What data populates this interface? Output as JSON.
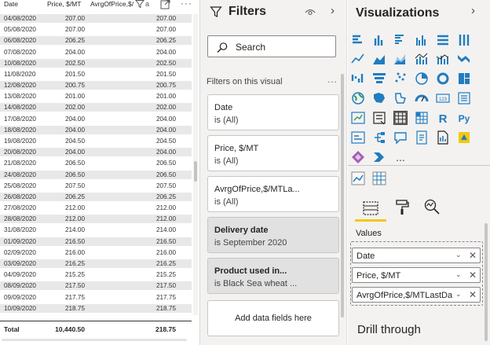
{
  "table": {
    "headers": {
      "date": "Date",
      "price": "Price, $/MT",
      "avg": "AvrgOfPrice,$/"
    },
    "header_overlay_text": "a",
    "rows": [
      {
        "date": "04/08/2020",
        "price": "207.00",
        "avg": "207.00"
      },
      {
        "date": "05/08/2020",
        "price": "207.00",
        "avg": "207.00"
      },
      {
        "date": "06/08/2020",
        "price": "206.25",
        "avg": "206.25"
      },
      {
        "date": "07/08/2020",
        "price": "204.00",
        "avg": "204.00"
      },
      {
        "date": "10/08/2020",
        "price": "202.50",
        "avg": "202.50"
      },
      {
        "date": "11/08/2020",
        "price": "201.50",
        "avg": "201.50"
      },
      {
        "date": "12/08/2020",
        "price": "200.75",
        "avg": "200.75"
      },
      {
        "date": "13/08/2020",
        "price": "201.00",
        "avg": "201.00"
      },
      {
        "date": "14/08/2020",
        "price": "202.00",
        "avg": "202.00"
      },
      {
        "date": "17/08/2020",
        "price": "204.00",
        "avg": "204.00"
      },
      {
        "date": "18/08/2020",
        "price": "204.00",
        "avg": "204.00"
      },
      {
        "date": "19/08/2020",
        "price": "204.50",
        "avg": "204.50"
      },
      {
        "date": "20/08/2020",
        "price": "204.00",
        "avg": "204.00"
      },
      {
        "date": "21/08/2020",
        "price": "206.50",
        "avg": "206.50"
      },
      {
        "date": "24/08/2020",
        "price": "206.50",
        "avg": "206.50"
      },
      {
        "date": "25/08/2020",
        "price": "207.50",
        "avg": "207.50"
      },
      {
        "date": "26/08/2020",
        "price": "206.25",
        "avg": "206.25"
      },
      {
        "date": "27/08/2020",
        "price": "212.00",
        "avg": "212.00"
      },
      {
        "date": "28/08/2020",
        "price": "212.00",
        "avg": "212.00"
      },
      {
        "date": "31/08/2020",
        "price": "214.00",
        "avg": "214.00"
      },
      {
        "date": "01/09/2020",
        "price": "216.50",
        "avg": "216.50"
      },
      {
        "date": "02/09/2020",
        "price": "216.00",
        "avg": "216.00"
      },
      {
        "date": "03/09/2020",
        "price": "216.25",
        "avg": "216.25"
      },
      {
        "date": "04/09/2020",
        "price": "215.25",
        "avg": "215.25"
      },
      {
        "date": "08/09/2020",
        "price": "217.50",
        "avg": "217.50"
      },
      {
        "date": "09/09/2020",
        "price": "217.75",
        "avg": "217.75"
      },
      {
        "date": "10/09/2020",
        "price": "218.75",
        "avg": "218.75"
      }
    ],
    "total": {
      "label": "Total",
      "price": "10,440.50",
      "avg": "218.75"
    }
  },
  "filters": {
    "title": "Filters",
    "search_placeholder": "Search",
    "section_label": "Filters on this visual",
    "more_label": "...",
    "cards": [
      {
        "title": "Date",
        "subtitle": "is (All)",
        "active": false
      },
      {
        "title": "Price, $/MT",
        "subtitle": "is (All)",
        "active": false
      },
      {
        "title": "AvrgOfPrice,$/MTLa...",
        "subtitle": "is (All)",
        "active": false
      },
      {
        "title": "Delivery date",
        "subtitle": "is September 2020",
        "active": true
      },
      {
        "title": "Product used in...",
        "subtitle": "is Black Sea wheat ...",
        "active": true
      }
    ],
    "add_fields_label": "Add data fields here"
  },
  "visualizations": {
    "title": "Visualizations",
    "more_visuals_label": "...",
    "r_visual_label": "R",
    "python_visual_label": "Py",
    "values_label": "Values",
    "value_wells": [
      "Date",
      "Price, $/MT",
      "AvrgOfPrice,$/MTLastDa"
    ],
    "drill_through_label": "Drill through"
  },
  "icons": {
    "accent": "#217cc0",
    "highlight": "#f2c811",
    "gauge_label": "123"
  }
}
